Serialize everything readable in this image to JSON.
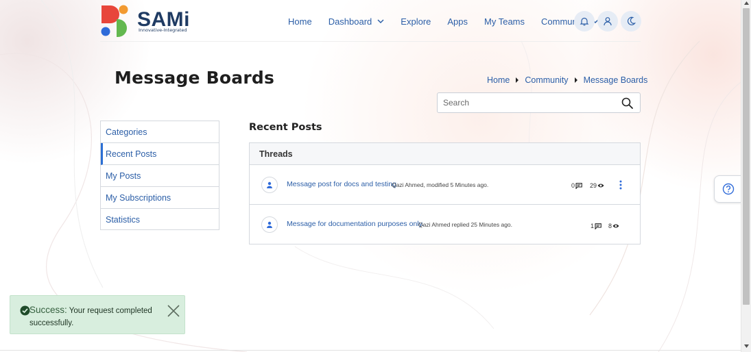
{
  "brand": {
    "name": "SAMi",
    "tagline": "Innovative-Integrated",
    "colors": {
      "red": "#e8463b",
      "orange": "#f29a31",
      "blue": "#2f6bd9",
      "green": "#63b84f",
      "navy": "#1f3b63"
    }
  },
  "nav": {
    "items": [
      {
        "label": "Home",
        "dropdown": false
      },
      {
        "label": "Dashboard",
        "dropdown": true
      },
      {
        "label": "Explore",
        "dropdown": false
      },
      {
        "label": "Apps",
        "dropdown": false
      },
      {
        "label": "My Teams",
        "dropdown": false
      },
      {
        "label": "Community",
        "dropdown": true
      }
    ],
    "icons": [
      "bell-icon",
      "user-icon",
      "moon-icon"
    ]
  },
  "page": {
    "title": "Message Boards"
  },
  "breadcrumb": [
    "Home",
    "Community",
    "Message Boards"
  ],
  "search": {
    "placeholder": "Search",
    "value": ""
  },
  "sidebar": {
    "items": [
      {
        "label": "Categories",
        "active": false
      },
      {
        "label": "Recent Posts",
        "active": true
      },
      {
        "label": "My Posts",
        "active": false
      },
      {
        "label": "My Subscriptions",
        "active": false
      },
      {
        "label": "Statistics",
        "active": false
      }
    ]
  },
  "main": {
    "section_title": "Recent Posts",
    "threads_header": "Threads",
    "threads": [
      {
        "title": "Message post for docs and testing",
        "meta": "Qazi Ahmed, modified 5 Minutes ago.",
        "replies": "0",
        "views": "29"
      },
      {
        "title": "Message for documentation purposes only.",
        "meta": "Qazi Ahmed replied 25 Minutes ago.",
        "replies": "1",
        "views": "8"
      }
    ]
  },
  "toast": {
    "lead": "Success:",
    "message": "Your request completed successfully."
  },
  "colors": {
    "link": "#2b5ea7",
    "accent": "#2b6fd4",
    "toast_bg": "#d8eede"
  }
}
